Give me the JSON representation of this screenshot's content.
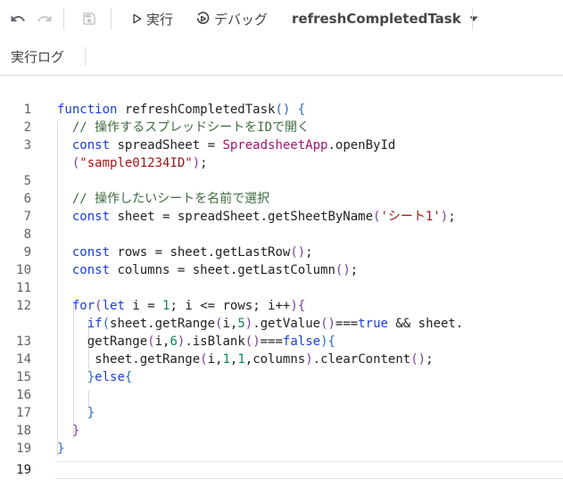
{
  "toolbar": {
    "run_label": "実行",
    "debug_label": "デバッグ",
    "function_name": "refreshCompletedTask"
  },
  "secondary": {
    "log_label": "実行ログ"
  },
  "code": {
    "line_numbers": [
      "1",
      "2",
      "3",
      "",
      "5",
      "6",
      "7",
      "8",
      "9",
      "10",
      "11",
      "12",
      "",
      "13",
      "14",
      "15",
      "16",
      "17",
      "18",
      "19"
    ],
    "lines": [
      "function refreshCompletedTask() {",
      "  // 操作するスプレッドシートをIDで開く",
      "  const spreadSheet = SpreadsheetApp.openById",
      "  (\"sample01234ID\");",
      "",
      "  // 操作したいシートを名前で選択",
      "  const sheet = spreadSheet.getSheetByName('シート1');",
      "",
      "  const rows = sheet.getLastRow();",
      "  const columns = sheet.getLastColumn();",
      "",
      "  for(let i = 1; i <= rows; i++){",
      "    if(sheet.getRange(i,5).getValue()===true && sheet.",
      "    getRange(i,6).isBlank()===false){",
      "      sheet.getRange(i,1,1,columns).clearContent();",
      "    }else{",
      "",
      "    }",
      "  }",
      "}"
    ]
  },
  "colors": {
    "keyword": "#1a3ed6",
    "class": "#a3136e",
    "string": "#a31515",
    "number": "#098658",
    "comment": "#3f6b3f"
  }
}
